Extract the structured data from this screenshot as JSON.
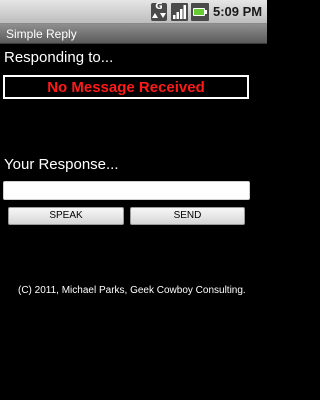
{
  "status_bar": {
    "time": "5:09 PM",
    "icons": [
      "data-network-g-icon",
      "signal-strength-icon",
      "battery-icon"
    ],
    "network_label": "G"
  },
  "app": {
    "title": "Simple Reply"
  },
  "message_section": {
    "label": "Responding to...",
    "message": "No Message Received",
    "message_color": "#ff1a1a"
  },
  "response_section": {
    "label": "Your Response...",
    "input_value": ""
  },
  "buttons": {
    "speak": "SPEAK",
    "send": "SEND"
  },
  "footer": {
    "copyright": "(C) 2011, Michael Parks, Geek Cowboy Consulting."
  }
}
